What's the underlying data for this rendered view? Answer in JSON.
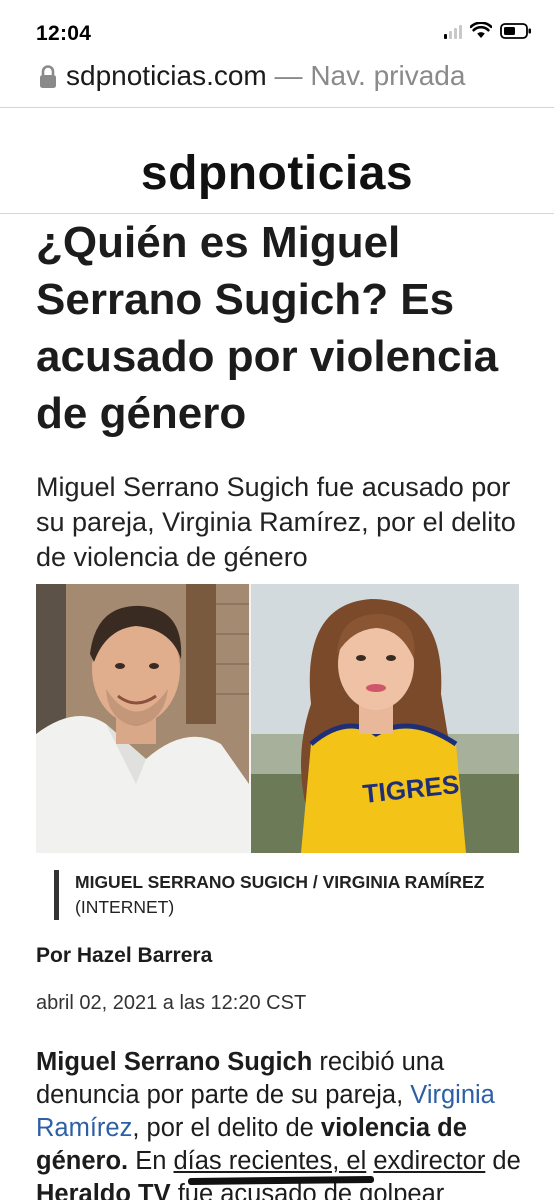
{
  "status_bar": {
    "time": "12:04",
    "icons": [
      "signal-icon",
      "wifi-icon",
      "battery-icon"
    ]
  },
  "url_bar": {
    "domain": "sdpnoticias.com",
    "separator": " — ",
    "mode": "Nav. privada"
  },
  "site": {
    "logo": "sdpnoticias"
  },
  "article": {
    "headline": "¿Quién es Miguel Serrano Sugich? Es acusado por violencia de género",
    "subtitle": "Miguel Serrano Sugich fue acusado por su pareja, Virginia Ramírez, por el delito de violencia de género",
    "caption_names": "MIGUEL SERRANO SUGICH / VIRGINIA RAMÍREZ",
    "caption_credit": " (INTERNET)",
    "byline": "Por Hazel Barrera",
    "date": "abril 02, 2021 a las 12:20 CST",
    "shirt_text": "TIGRES",
    "body": {
      "p1_bold1": "Miguel Serrano Sugich",
      "p1_text1": " recibió una denuncia por parte de su pareja, ",
      "p1_link": "Virginia Ramírez",
      "p1_text2": ", por el delito de ",
      "p1_bold2": "violencia de género.",
      "p1_text3": " En ",
      "p1_ul1": "días recientes, el",
      "p1_text4": " ",
      "p1_ul2": "exdirector",
      "p1_text5": " de ",
      "p1_bold3": "Heraldo TV",
      "p1_text6": " fue acusado de golpear"
    }
  },
  "colors": {
    "link": "#2d5fa6",
    "private_text": "#8a8a8a",
    "shirt": "#f3c318"
  }
}
